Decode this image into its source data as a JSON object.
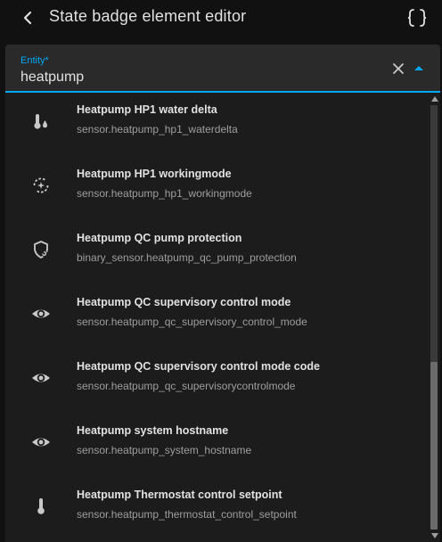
{
  "header": {
    "title": "State badge element editor"
  },
  "field": {
    "label": "Entity*",
    "value": "heatpump"
  },
  "results": [
    {
      "name": "Heatpump HP1 water delta",
      "entity_id": "sensor.heatpump_hp1_waterdelta",
      "icon": "thermometer-water-icon"
    },
    {
      "name": "Heatpump HP1 workingmode",
      "entity_id": "sensor.heatpump_hp1_workingmode",
      "icon": "auto-mode-icon"
    },
    {
      "name": "Heatpump QC pump protection",
      "entity_id": "binary_sensor.heatpump_qc_pump_protection",
      "icon": "shield-refresh-icon"
    },
    {
      "name": "Heatpump QC supervisory control mode",
      "entity_id": "sensor.heatpump_qc_supervisory_control_mode",
      "icon": "eye-icon"
    },
    {
      "name": "Heatpump QC supervisory control mode code",
      "entity_id": "sensor.heatpump_qc_supervisorycontrolmode",
      "icon": "eye-icon"
    },
    {
      "name": "Heatpump system hostname",
      "entity_id": "sensor.heatpump_system_hostname",
      "icon": "eye-icon"
    },
    {
      "name": "Heatpump Thermostat control setpoint",
      "entity_id": "sensor.heatpump_thermostat_control_setpoint",
      "icon": "thermometer-icon"
    }
  ],
  "colors": {
    "accent": "#03a9f4",
    "background": "#111111",
    "list_background": "#1c1c1c",
    "field_background": "#2a2a2a",
    "primary_text": "#e1e1e1",
    "secondary_text": "#9e9e9e"
  }
}
